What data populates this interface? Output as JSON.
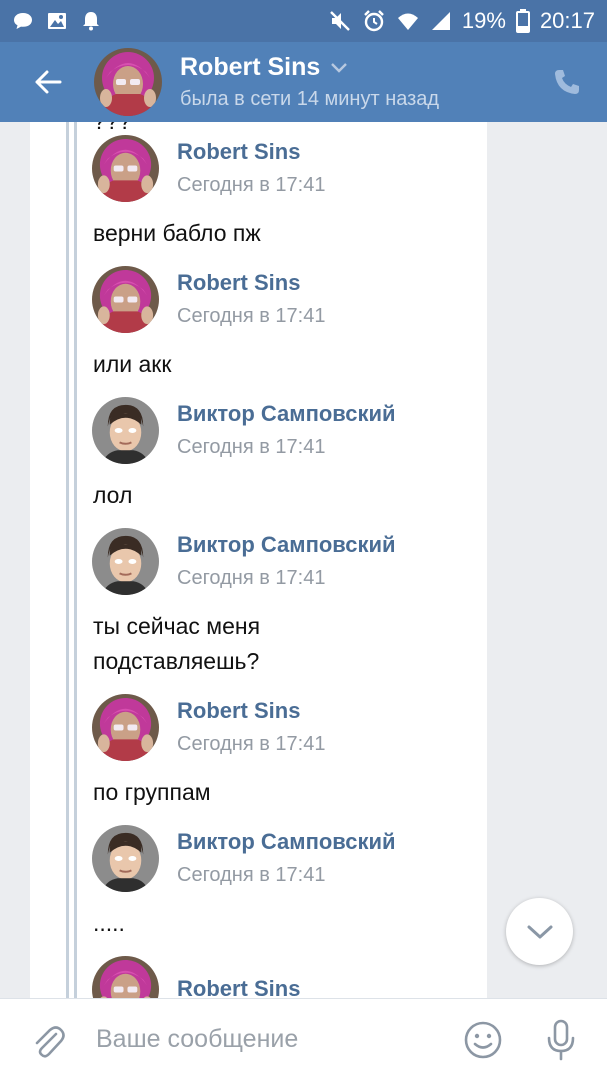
{
  "status_bar": {
    "battery": "19%",
    "time": "20:17",
    "icons": [
      "chat-bubble-icon",
      "image-icon",
      "bell-icon",
      "mute-icon",
      "alarm-icon",
      "wifi-icon",
      "signal-icon",
      "battery-icon"
    ]
  },
  "header": {
    "name": "Robert Sins",
    "status": "была в сети 14 минут назад"
  },
  "chat": {
    "top_text": "???",
    "messages": [
      {
        "author": "Robert Sins",
        "time": "Сегодня в 17:41",
        "text": "верни бабло пж",
        "avatar": "pink-hair"
      },
      {
        "author": "Robert Sins",
        "time": "Сегодня в 17:41",
        "text": "или акк",
        "avatar": "pink-hair"
      },
      {
        "author": "Виктор Самповский",
        "time": "Сегодня в 17:41",
        "text": "лол",
        "avatar": "cartoon-man"
      },
      {
        "author": "Виктор Самповский",
        "time": "Сегодня в 17:41",
        "text_line1": "ты сейчас меня",
        "text_line2": "подставляешь?",
        "avatar": "cartoon-man"
      },
      {
        "author": "Robert Sins",
        "time": "Сегодня в 17:41",
        "text": "по группам",
        "avatar": "pink-hair"
      },
      {
        "author": "Виктор Самповский",
        "time": "Сегодня в 17:41",
        "text": ".....",
        "avatar": "cartoon-man"
      },
      {
        "author": "Robert Sins",
        "avatar": "pink-hair"
      }
    ]
  },
  "composer": {
    "placeholder": "Ваше сообщение"
  },
  "colors": {
    "header": "#5181b8",
    "status_bar": "#4a73a7",
    "chat_bg": "#ebedf0",
    "name_link": "#4a6d95",
    "time_gray": "#939aa3"
  }
}
